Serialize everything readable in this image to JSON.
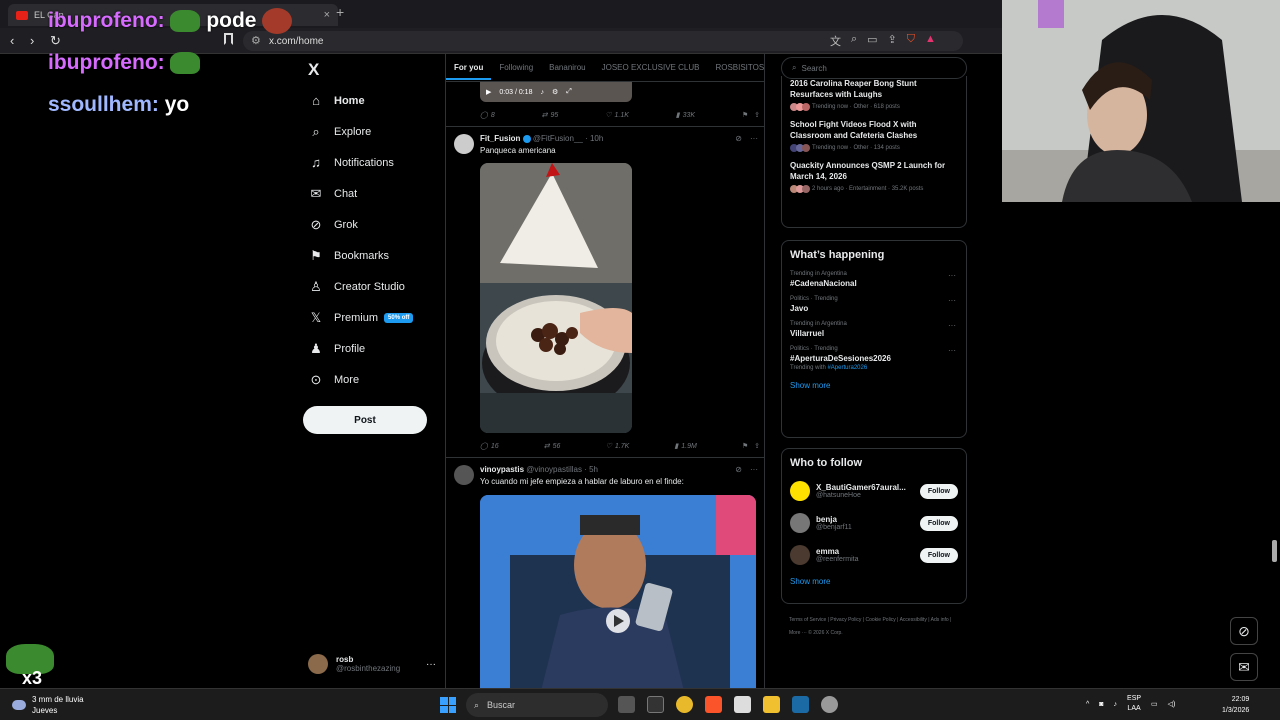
{
  "browser": {
    "tab_title": "EL Cap",
    "url": "x.com/home",
    "new_tab": "+",
    "close": "×"
  },
  "chat_overlay": {
    "lines": [
      {
        "user": "ibuprofeno:",
        "message": "pode"
      },
      {
        "user": "ibuprofeno:",
        "message": ""
      },
      {
        "user": "ssoullhem:",
        "message": "yo"
      }
    ]
  },
  "sidebar": {
    "logo": "X",
    "items": [
      {
        "label": "Home",
        "icon": "home-icon"
      },
      {
        "label": "Explore",
        "icon": "search-icon"
      },
      {
        "label": "Notifications",
        "icon": "bell-icon"
      },
      {
        "label": "Chat",
        "icon": "mail-icon"
      },
      {
        "label": "Grok",
        "icon": "grok-icon"
      },
      {
        "label": "Bookmarks",
        "icon": "bookmark-icon"
      },
      {
        "label": "Creator Studio",
        "icon": "creator-icon"
      },
      {
        "label": "Premium",
        "icon": "x-icon",
        "badge": "50% off"
      },
      {
        "label": "Profile",
        "icon": "person-icon"
      },
      {
        "label": "More",
        "icon": "more-icon"
      }
    ],
    "post_button": "Post",
    "account": {
      "name": "rosb",
      "handle": "@rosbinthezazing",
      "menu": "···"
    }
  },
  "feed": {
    "tabs": [
      "For you",
      "Following",
      "Bananirou",
      "JOSEO EXCLUSIVE CLUB",
      "ROSBISITOS"
    ],
    "top_video": {
      "time": "0:03 / 0:18"
    },
    "top_actions": {
      "replies": "8",
      "reposts": "95",
      "likes": "1.1K",
      "views": "33K"
    },
    "tweet1": {
      "name": "Fit_Fusion",
      "handle": "@FitFusion__",
      "time": "· 10h",
      "text": "Panqueca americana",
      "actions": {
        "replies": "16",
        "reposts": "56",
        "likes": "1.7K",
        "views": "1.9M"
      }
    },
    "tweet2": {
      "name": "vinoypastis",
      "handle": "@vinoypastillas",
      "time": "· 5h",
      "text": "Yo cuando mi jefe empieza a hablar de laburo en el finde:"
    }
  },
  "right": {
    "search_placeholder": "Search",
    "news": [
      {
        "title": "2016 Carolina Reaper Bong Stunt Resurfaces with Laughs",
        "meta": "Trending now · Other · 618 posts"
      },
      {
        "title": "School Fight Videos Flood X with Classroom and Cafeteria Clashes",
        "meta": "Trending now · Other · 134 posts"
      },
      {
        "title": "Quackity Announces QSMP 2 Launch for March 14, 2026",
        "meta": "2 hours ago · Entertainment · 35.2K posts"
      }
    ],
    "whats_happening": {
      "title": "What’s happening",
      "trends": [
        {
          "category": "Trending in Argentina",
          "name": "#CadenaNacional",
          "with": ""
        },
        {
          "category": "Politics · Trending",
          "name": "Javo",
          "with": ""
        },
        {
          "category": "Trending in Argentina",
          "name": "Villarruel",
          "with": ""
        },
        {
          "category": "Politics · Trending",
          "name": "#AperturaDeSesiones2026",
          "with_prefix": "Trending with",
          "with": "#Apertura2026"
        }
      ],
      "show_more": "Show more",
      "trend_menu": "···"
    },
    "who_to_follow": {
      "title": "Who to follow",
      "users": [
        {
          "name": "X_BautiGamer67aural...",
          "handle": "@hatsuneHoe"
        },
        {
          "name": "benja",
          "handle": "@benjarf11"
        },
        {
          "name": "emma",
          "handle": "@reenfermita"
        }
      ],
      "follow_label": "Follow",
      "show_more": "Show more"
    },
    "footer": "Terms of Service  |  Privacy Policy  |  Cookie Policy  |  Accessibility  |  Ads info  |  More ···  © 2026 X Corp."
  },
  "taskbar": {
    "weather_line1": "3 mm de lluvia",
    "weather_line2": "Jueves",
    "search": "Buscar",
    "lang1": "ESP",
    "lang2": "LAA",
    "time": "22:09",
    "date": "1/3/2026"
  },
  "overlay_badge": "x3",
  "colors": {
    "accent": "#1d9bf0",
    "background": "#000000",
    "text": "#e7e9ea",
    "muted": "#71767b"
  }
}
